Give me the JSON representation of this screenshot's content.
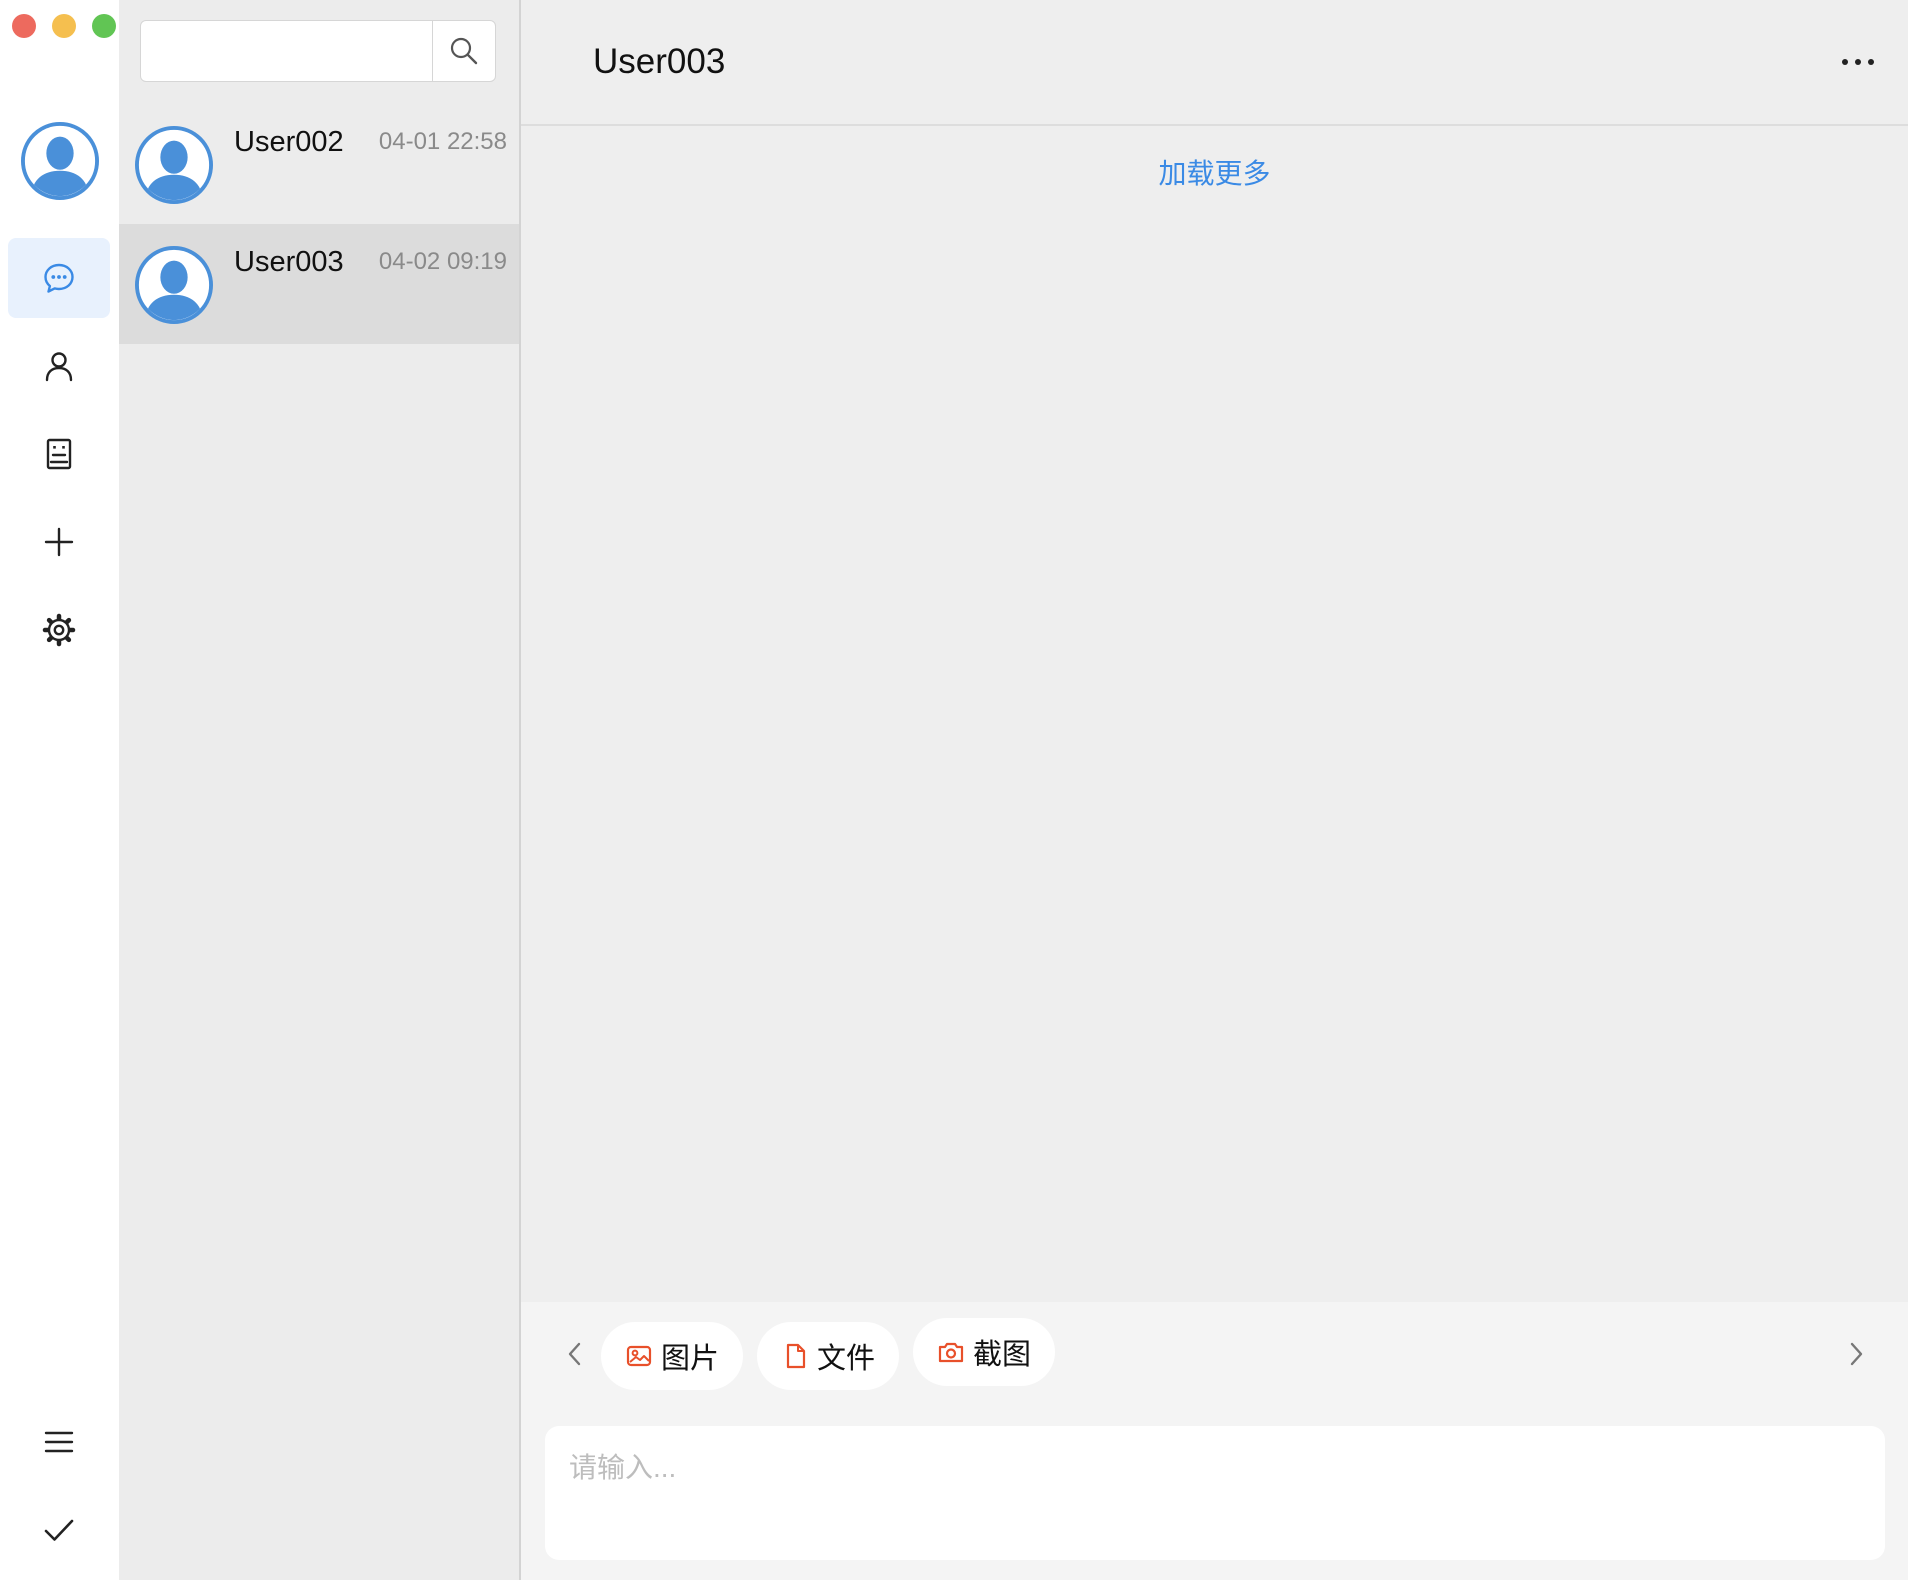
{
  "colors": {
    "accent": "#3a8ae5",
    "avatar_blue": "#4a90d9",
    "tool_icon": "#e8502a",
    "selected_row": "#dcdcdc"
  },
  "nav": {
    "items": [
      {
        "icon": "chat-bubble-icon",
        "active": true
      },
      {
        "icon": "user-icon",
        "active": false
      },
      {
        "icon": "contact-card-icon",
        "active": false
      },
      {
        "icon": "plus-icon",
        "active": false
      },
      {
        "icon": "gear-icon",
        "active": false
      }
    ],
    "bottom_items": [
      {
        "icon": "menu-icon"
      },
      {
        "icon": "check-icon"
      }
    ]
  },
  "search": {
    "placeholder": "",
    "value": ""
  },
  "conversations": [
    {
      "name": "User002",
      "time": "04-01 22:58",
      "selected": false
    },
    {
      "name": "User003",
      "time": "04-02 09:19",
      "selected": true
    }
  ],
  "chat": {
    "title": "User003",
    "load_more": "加载更多",
    "tools": [
      {
        "label": "图片",
        "icon": "image-icon"
      },
      {
        "label": "文件",
        "icon": "file-icon"
      },
      {
        "label": "截图",
        "icon": "camera-icon"
      }
    ],
    "input_placeholder": "请输入..."
  }
}
